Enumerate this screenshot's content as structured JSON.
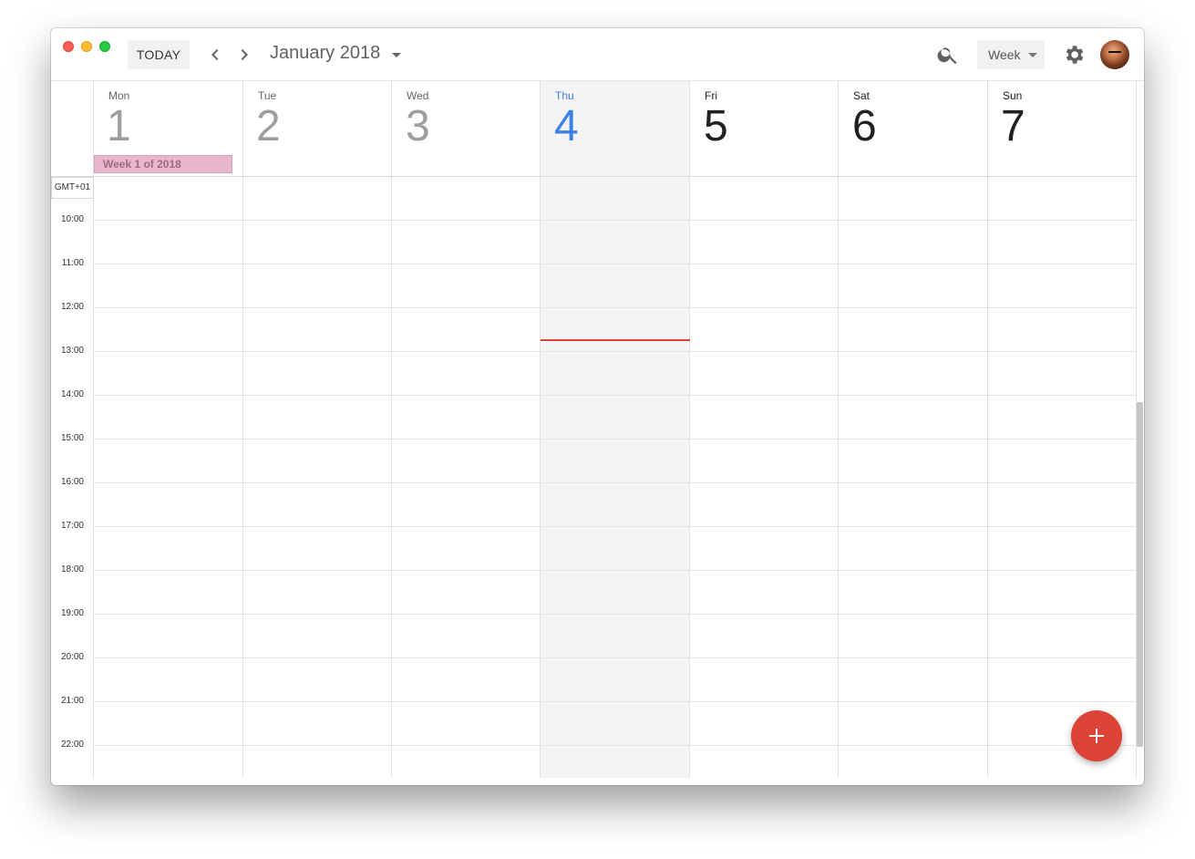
{
  "toolbar": {
    "today_label": "TODAY",
    "month_title": "January 2018",
    "view_select": "Week"
  },
  "week": {
    "days": [
      {
        "name": "Mon",
        "date": "1",
        "state": "past"
      },
      {
        "name": "Tue",
        "date": "2",
        "state": "past"
      },
      {
        "name": "Wed",
        "date": "3",
        "state": "past"
      },
      {
        "name": "Thu",
        "date": "4",
        "state": "today"
      },
      {
        "name": "Fri",
        "date": "5",
        "state": "future"
      },
      {
        "name": "Sat",
        "date": "6",
        "state": "future"
      },
      {
        "name": "Sun",
        "date": "7",
        "state": "future"
      }
    ],
    "all_day_event": "Week 1 of 2018",
    "timezone_label": "GMT+01",
    "hours": [
      "10:00",
      "11:00",
      "12:00",
      "13:00",
      "14:00",
      "15:00",
      "16:00",
      "17:00",
      "18:00",
      "19:00",
      "20:00",
      "21:00",
      "22:00"
    ]
  },
  "colors": {
    "today_accent": "#3b80e8",
    "now_indicator": "#db4437",
    "fab": "#db4437",
    "event_chip": "#e8b6cd"
  },
  "icons": {
    "prev": "chevron-left-icon",
    "next": "chevron-right-icon",
    "month_dropdown": "caret-down-icon",
    "search": "search-icon",
    "settings": "gear-icon",
    "create": "plus-icon"
  }
}
